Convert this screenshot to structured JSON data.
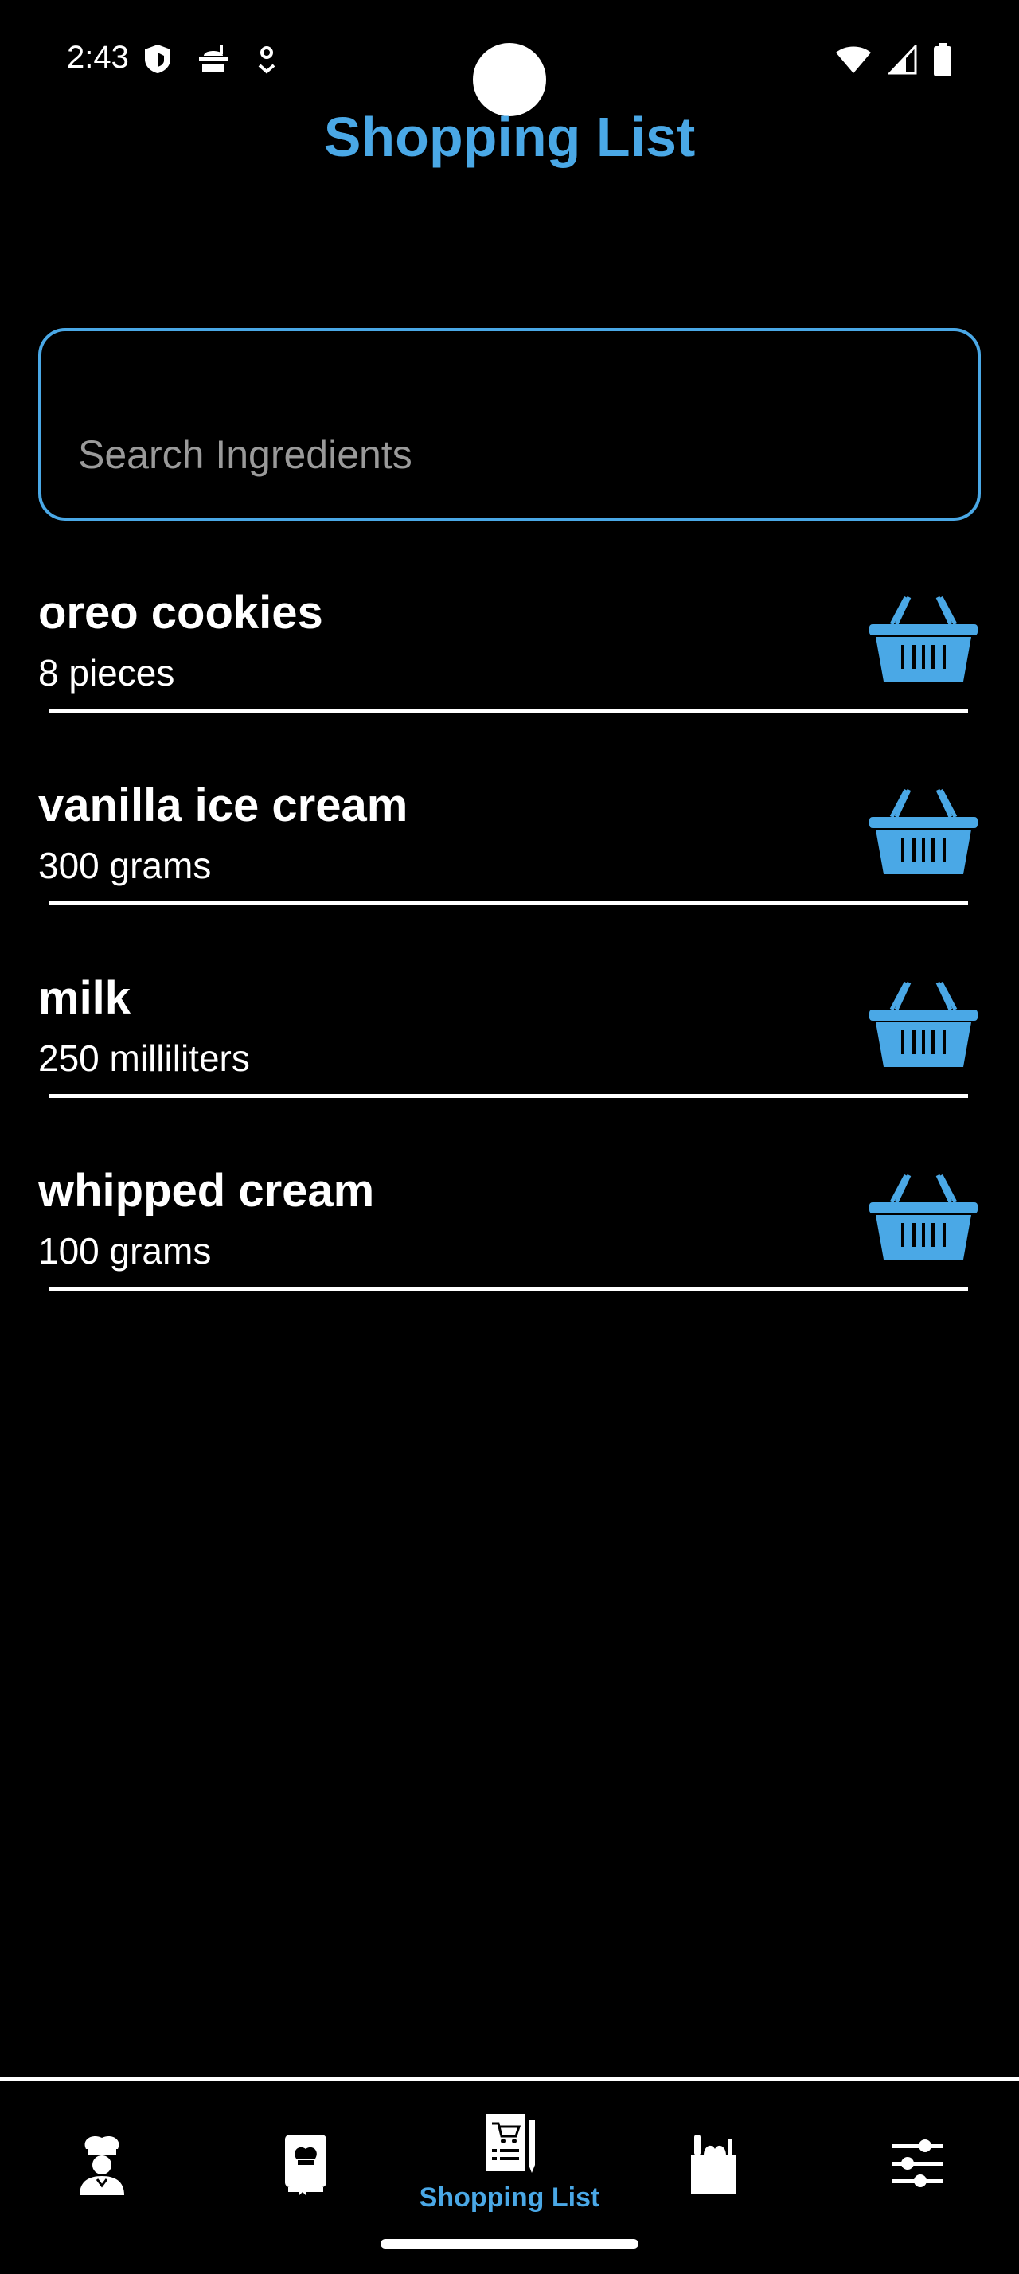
{
  "status_bar": {
    "time": "2:43",
    "left_icons": [
      "shield-icon",
      "food-icon",
      "location-icon"
    ],
    "right_icons": [
      "wifi-icon",
      "signal-icon",
      "battery-icon"
    ]
  },
  "header": {
    "title": "Shopping List"
  },
  "search": {
    "placeholder": "Search Ingredients",
    "value": ""
  },
  "items": [
    {
      "name": "oreo cookies",
      "quantity": "8 pieces"
    },
    {
      "name": "vanilla ice cream",
      "quantity": "300 grams"
    },
    {
      "name": "milk",
      "quantity": "250 milliliters"
    },
    {
      "name": "whipped cream",
      "quantity": "100 grams"
    }
  ],
  "bottom_nav": {
    "items": [
      {
        "icon": "chef-icon",
        "label": ""
      },
      {
        "icon": "recipe-book-icon",
        "label": ""
      },
      {
        "icon": "shopping-list-icon",
        "label": "Shopping List",
        "active": true
      },
      {
        "icon": "groceries-icon",
        "label": ""
      },
      {
        "icon": "settings-sliders-icon",
        "label": ""
      }
    ]
  },
  "colors": {
    "accent": "#4aa8e6",
    "background": "#000000",
    "text": "#ffffff"
  }
}
